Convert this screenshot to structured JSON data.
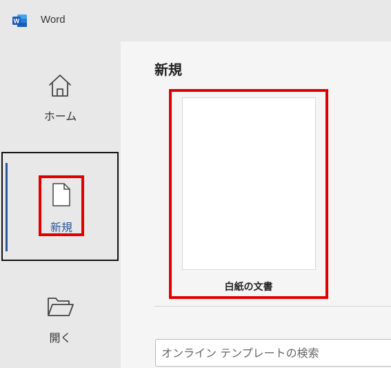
{
  "app": {
    "title": "Word",
    "logo_letter": "W"
  },
  "sidebar": {
    "items": [
      {
        "label": "ホーム",
        "icon": "home-icon"
      },
      {
        "label": "新規",
        "icon": "new-document-icon",
        "selected": true
      },
      {
        "label": "開く",
        "icon": "folder-open-icon"
      }
    ]
  },
  "main": {
    "title": "新規",
    "templates": [
      {
        "label": "白紙の文書"
      }
    ],
    "search": {
      "placeholder": "オンライン テンプレートの検索",
      "value": ""
    }
  },
  "colors": {
    "accent": "#2b579a",
    "highlight": "#e00000",
    "sidebar_bg": "#e8e8e8",
    "main_bg": "#f5f5f5"
  }
}
